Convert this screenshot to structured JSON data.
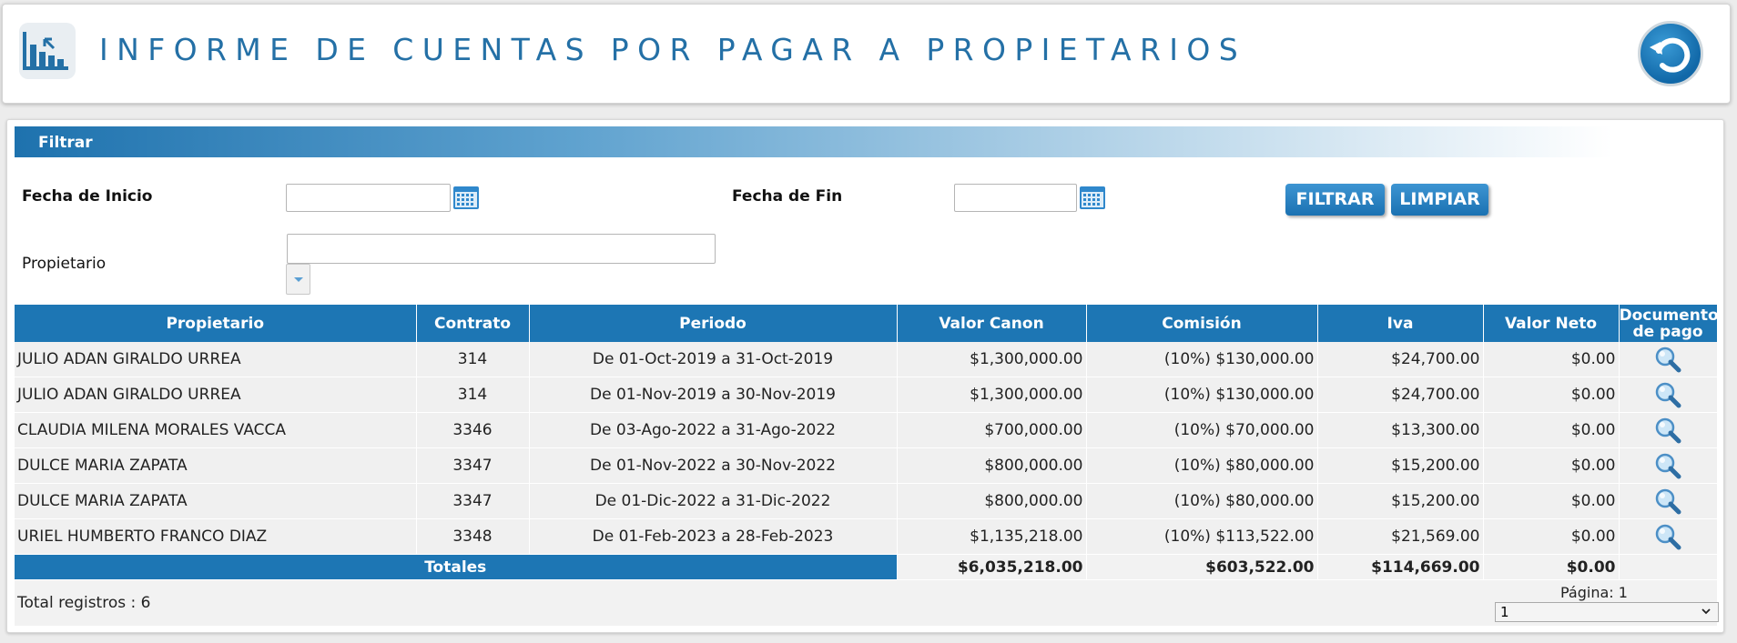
{
  "header": {
    "title": "INFORME DE CUENTAS POR PAGAR A PROPIETARIOS",
    "icon": "report-chart-icon",
    "back_icon": "back-arrow-icon"
  },
  "filter": {
    "section_title": "Filtrar",
    "start_date_label": "Fecha de Inicio",
    "start_date_value": "",
    "end_date_label": "Fecha de Fin",
    "end_date_value": "",
    "owner_label": "Propietario",
    "owner_value": "",
    "filter_button": "FILTRAR",
    "clear_button": "LIMPIAR"
  },
  "table": {
    "columns": [
      "Propietario",
      "Contrato",
      "Periodo",
      "Valor Canon",
      "Comisión",
      "Iva",
      "Valor Neto",
      "Documento de pago"
    ],
    "rows": [
      {
        "owner": "JULIO ADAN GIRALDO URREA",
        "contract": "314",
        "period": "De 01-Oct-2019 a 31-Oct-2019",
        "canon": "$1,300,000.00",
        "commission": "(10%) $130,000.00",
        "iva": "$24,700.00",
        "net": "$0.00"
      },
      {
        "owner": "JULIO ADAN GIRALDO URREA",
        "contract": "314",
        "period": "De 01-Nov-2019 a 30-Nov-2019",
        "canon": "$1,300,000.00",
        "commission": "(10%) $130,000.00",
        "iva": "$24,700.00",
        "net": "$0.00"
      },
      {
        "owner": "CLAUDIA MILENA MORALES VACCA",
        "contract": "3346",
        "period": "De 03-Ago-2022 a 31-Ago-2022",
        "canon": "$700,000.00",
        "commission": "(10%) $70,000.00",
        "iva": "$13,300.00",
        "net": "$0.00"
      },
      {
        "owner": "DULCE MARIA ZAPATA",
        "contract": "3347",
        "period": "De 01-Nov-2022 a 30-Nov-2022",
        "canon": "$800,000.00",
        "commission": "(10%) $80,000.00",
        "iva": "$15,200.00",
        "net": "$0.00"
      },
      {
        "owner": "DULCE MARIA ZAPATA",
        "contract": "3347",
        "period": "De 01-Dic-2022 a 31-Dic-2022",
        "canon": "$800,000.00",
        "commission": "(10%) $80,000.00",
        "iva": "$15,200.00",
        "net": "$0.00"
      },
      {
        "owner": "URIEL HUMBERTO FRANCO DIAZ",
        "contract": "3348",
        "period": "De 01-Feb-2023 a 28-Feb-2023",
        "canon": "$1,135,218.00",
        "commission": "(10%) $113,522.00",
        "iva": "$21,569.00",
        "net": "$0.00"
      }
    ],
    "totals": {
      "label": "Totales",
      "canon": "$6,035,218.00",
      "commission": "$603,522.00",
      "iva": "$114,669.00",
      "net": "$0.00"
    },
    "total_records": "Total registros : 6",
    "page_label": "Página:  1",
    "page_value": "1"
  },
  "colors": {
    "primary": "#1d76b4",
    "title": "#2470a6"
  }
}
